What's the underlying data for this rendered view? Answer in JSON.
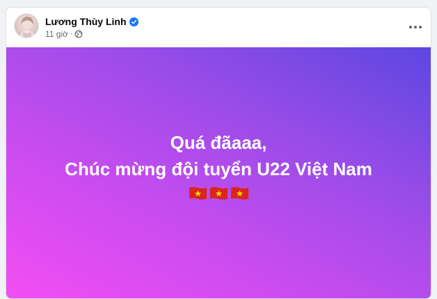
{
  "post": {
    "author": "Lương Thùy Linh",
    "verified_icon": "verified-badge-icon",
    "time": "11 giờ",
    "separator": "·",
    "privacy_icon": "globe-icon",
    "more_icon": "more-options-icon",
    "text_line1": "Quá đãaaa,",
    "text_line2": "Chúc mừng đội tuyển U22 Việt Nam",
    "emoji": [
      "vietnam-flag-icon",
      "vietnam-flag-icon",
      "vietnam-flag-icon"
    ]
  },
  "colors": {
    "verified": "#1877f2",
    "bg_start": "#f34ef3",
    "bg_end": "#5c47e0",
    "flag_red": "#da251d",
    "flag_star": "#ffde00"
  }
}
